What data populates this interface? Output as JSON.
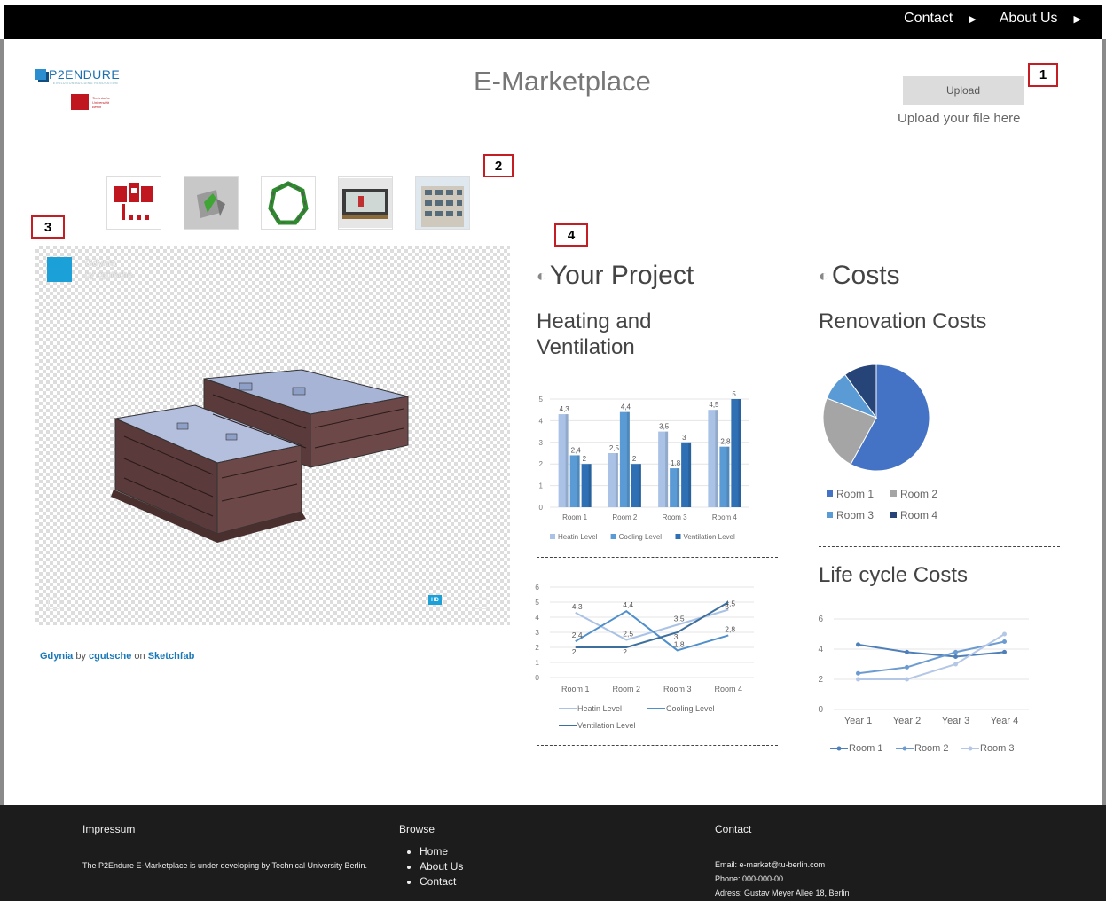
{
  "nav": {
    "contact": "Contact",
    "about": "About Us"
  },
  "logo": {
    "brand": "P2ENDURE",
    "tagline": "EVOLUTION BUILDING RENOVATION",
    "university": [
      "Technische",
      "Universität",
      "Berlin"
    ]
  },
  "header": {
    "title": "E-Marketplace",
    "upload_label": "Upload",
    "upload_caption": "Upload your file here"
  },
  "markers": [
    "1",
    "2",
    "3",
    "4"
  ],
  "thumbnails": [
    "building-plan-icon",
    "3d-model-icon",
    "ring-structure-icon",
    "panel-component-icon",
    "building-photo-icon"
  ],
  "viewer": {
    "model_name": "Gdynia",
    "model_author": "by cgutsche",
    "hd": "HD"
  },
  "credit": {
    "model": "Gdynia",
    "by": "by",
    "author": "cgutsche",
    "on": "on",
    "platform": "Sketchfab"
  },
  "project": {
    "title": "Your Project",
    "subtitle_line1": "Heating and",
    "subtitle_line2": "Ventilation"
  },
  "costs": {
    "title": "Costs",
    "subtitle_renovation": "Renovation Costs",
    "subtitle_lifecycle": "Life cycle Costs"
  },
  "chart_data": [
    {
      "type": "bar",
      "title": "",
      "categories": [
        "Room 1",
        "Room 2",
        "Room 3",
        "Room 4"
      ],
      "series": [
        {
          "name": "Heatin Level",
          "values": [
            4.3,
            2.5,
            3.5,
            4.5
          ],
          "color": "#a9c2e6"
        },
        {
          "name": "Cooling Level",
          "values": [
            2.4,
            4.4,
            1.8,
            2.8
          ],
          "color": "#5b9bd5"
        },
        {
          "name": "Ventilation Level",
          "values": [
            2,
            2,
            3,
            5
          ],
          "color": "#2f6fb3"
        }
      ],
      "data_labels": [
        [
          "4,3",
          "2,4",
          "2"
        ],
        [
          "2,5",
          "4,4",
          "2"
        ],
        [
          "3,5",
          "1,8",
          "3"
        ],
        [
          "4,5",
          "2,8",
          "5"
        ]
      ],
      "yticks": [
        "0",
        "1",
        "2",
        "3",
        "4",
        "5"
      ],
      "ylim": [
        0,
        5
      ],
      "legend": "bottom"
    },
    {
      "type": "line",
      "title": "",
      "categories": [
        "Room 1",
        "Room 2",
        "Room 3",
        "Room 4"
      ],
      "series": [
        {
          "name": "Heatin Level",
          "values": [
            4.3,
            2.5,
            3.5,
            4.5
          ],
          "color": "#a9c2e6"
        },
        {
          "name": "Cooling Level",
          "values": [
            2.4,
            4.4,
            1.8,
            2.8
          ],
          "color": "#4e8fcc"
        },
        {
          "name": "Ventilation Level",
          "values": [
            2,
            2,
            3,
            5
          ],
          "color": "#3d6f9e"
        }
      ],
      "data_labels": [
        [
          "4,3",
          "2,5",
          "3,5",
          "4,5"
        ],
        [
          "2,4",
          "4,4",
          "1,8",
          "2,8"
        ],
        [
          "2",
          "2",
          "3",
          "5"
        ]
      ],
      "yticks": [
        "0",
        "1",
        "2",
        "3",
        "4",
        "5",
        "6"
      ],
      "ylim": [
        0,
        6
      ],
      "legend": "bottom"
    },
    {
      "type": "pie",
      "title": "",
      "labels": [
        "Room 1",
        "Room 2",
        "Room 3",
        "Room 4"
      ],
      "values": [
        58,
        23,
        9,
        10
      ],
      "colors": [
        "#4472c4",
        "#a5a5a5",
        "#5b9bd5",
        "#264478"
      ],
      "legend": "bottom"
    },
    {
      "type": "line",
      "title": "",
      "categories": [
        "Year 1",
        "Year 2",
        "Year 3",
        "Year 4"
      ],
      "series": [
        {
          "name": "Room 1",
          "values": [
            4.3,
            3.8,
            3.5,
            3.8
          ],
          "color": "#4e7fb8"
        },
        {
          "name": "Room 2",
          "values": [
            2.4,
            2.8,
            3.8,
            4.5
          ],
          "color": "#6b9bd0"
        },
        {
          "name": "Room 3",
          "values": [
            2,
            2,
            3,
            5
          ],
          "color": "#b4c7e7"
        }
      ],
      "yticks": [
        "0",
        "2",
        "4",
        "6"
      ],
      "ylim": [
        0,
        6
      ],
      "legend": "bottom"
    }
  ],
  "footer": {
    "impressum_heading": "Impressum",
    "impressum_text": "The P2Endure E-Marketplace is under developing by Technical University Berlin.",
    "browse_heading": "Browse",
    "browse_links": [
      "Home",
      "About Us",
      "Contact"
    ],
    "contact_heading": "Contact",
    "email": "Email: e-market@tu-berlin.com",
    "phone": "Phone: 000-000-00",
    "address": "Adress: Gustav Meyer Allee 18, Berlin"
  }
}
